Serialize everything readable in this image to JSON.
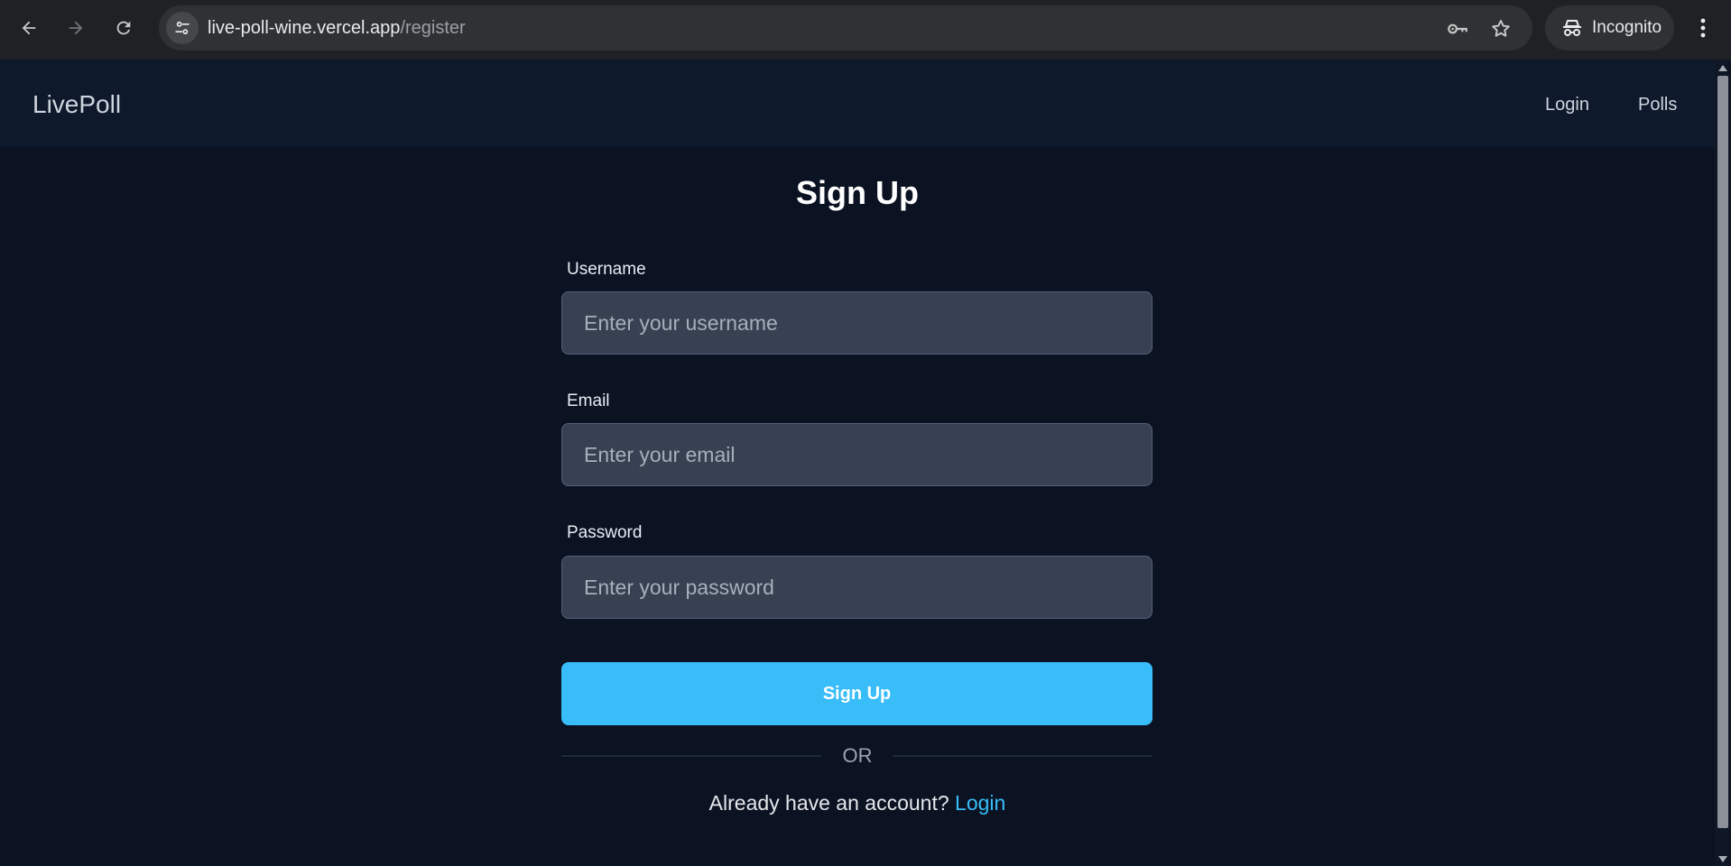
{
  "browser": {
    "url_host": "live-poll-wine.vercel.app",
    "url_path": "/register",
    "incognito_label": "Incognito",
    "icons": [
      "back-arrow-icon",
      "forward-arrow-icon",
      "reload-icon",
      "site-info-icon",
      "key-icon",
      "star-icon",
      "incognito-icon",
      "more-vert-icon"
    ]
  },
  "app": {
    "brand": "LivePoll",
    "nav": [
      {
        "label": "Login"
      },
      {
        "label": "Polls"
      }
    ]
  },
  "form": {
    "title": "Sign Up",
    "fields": [
      {
        "label": "Username",
        "placeholder": "Enter your username",
        "value": ""
      },
      {
        "label": "Email",
        "placeholder": "Enter your email",
        "value": ""
      },
      {
        "label": "Password",
        "placeholder": "Enter your password",
        "value": ""
      }
    ],
    "submit_label": "Sign Up",
    "divider_text": "OR",
    "footer_prompt": "Already have an account?",
    "footer_link": "Login"
  },
  "colors": {
    "background": "#0b1222",
    "navbar": "#0f192c",
    "input_bg": "#374151",
    "accent": "#38bdf8"
  }
}
